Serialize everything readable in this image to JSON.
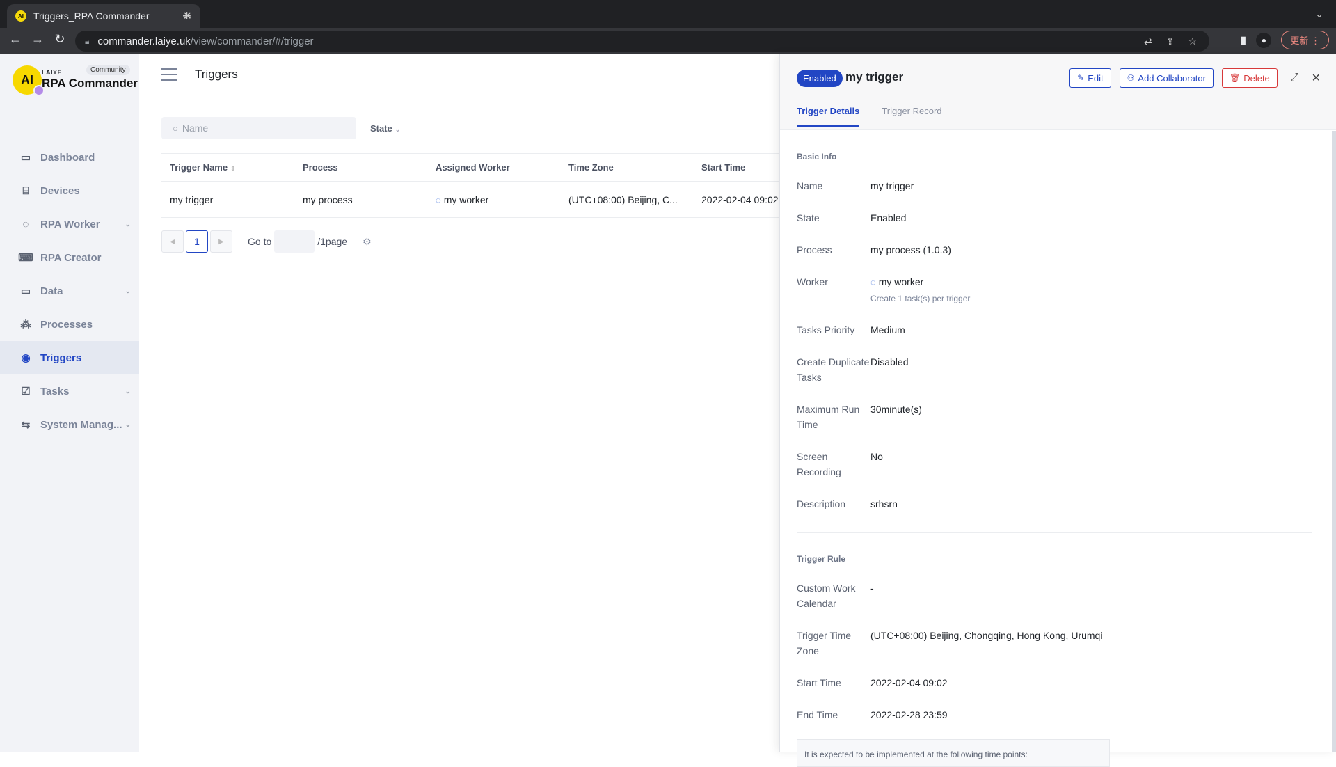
{
  "browser": {
    "tab_title": "Triggers_RPA Commander",
    "url_host": "commander.laiye.uk",
    "url_path": "/view/commander/#/trigger",
    "update_label": "更新"
  },
  "sidebar": {
    "brand_small": "LAIYE",
    "brand": "RPA Commander",
    "edition": "Community",
    "items": [
      {
        "label": "Dashboard",
        "icon": "monitor-chart-icon",
        "has_children": false
      },
      {
        "label": "Devices",
        "icon": "router-icon",
        "has_children": false
      },
      {
        "label": "RPA Worker",
        "icon": "robot-icon",
        "has_children": true
      },
      {
        "label": "RPA Creator",
        "icon": "terminal-icon",
        "has_children": false
      },
      {
        "label": "Data",
        "icon": "folder-icon",
        "has_children": true
      },
      {
        "label": "Processes",
        "icon": "flow-icon",
        "has_children": false
      },
      {
        "label": "Triggers",
        "icon": "broadcast-icon",
        "has_children": false,
        "active": true
      },
      {
        "label": "Tasks",
        "icon": "checkbox-icon",
        "has_children": true
      },
      {
        "label": "System Manag...",
        "icon": "settings-swap-icon",
        "has_children": true
      }
    ]
  },
  "main": {
    "title": "Triggers",
    "search_placeholder": "Name",
    "state_filter": "State",
    "columns": [
      "Trigger Name",
      "Process",
      "Assigned Worker",
      "Time Zone",
      "Start Time"
    ],
    "rows": [
      {
        "trigger_name": "my trigger",
        "process": "my process",
        "worker": "my worker",
        "time_zone": "(UTC+08:00) Beijing, C...",
        "start_time": "2022-02-04 09:02"
      }
    ],
    "pagination": {
      "current": "1",
      "goto_label": "Go to",
      "total_label": "/1page"
    }
  },
  "panel": {
    "status_badge": "Enabled",
    "title": "my trigger",
    "edit": "Edit",
    "add_collaborator": "Add Collaborator",
    "delete": "Delete",
    "tabs": [
      "Trigger Details",
      "Trigger Record"
    ],
    "basic_info_title": "Basic Info",
    "basic_info": [
      {
        "key": "Name",
        "value": "my trigger"
      },
      {
        "key": "State",
        "value": "Enabled"
      },
      {
        "key": "Process",
        "value": "my process (1.0.3)"
      },
      {
        "key": "Worker",
        "value": "my worker",
        "sub": "Create 1 task(s) per trigger"
      },
      {
        "key": "Tasks Priority",
        "value": "Medium"
      },
      {
        "key": "Create Duplicate Tasks",
        "value": "Disabled"
      },
      {
        "key": "Maximum Run Time",
        "value": "30minute(s)"
      },
      {
        "key": "Screen Recording",
        "value": "No"
      },
      {
        "key": "Description",
        "value": "srhsrn"
      }
    ],
    "trigger_rule_title": "Trigger Rule",
    "trigger_rule": [
      {
        "key": "Custom Work Calendar",
        "value": "-"
      },
      {
        "key": "Trigger Time Zone",
        "value": "(UTC+08:00) Beijing, Chongqing, Hong Kong, Urumqi"
      },
      {
        "key": "Start Time",
        "value": "2022-02-04 09:02"
      },
      {
        "key": "End Time",
        "value": "2022-02-28 23:59"
      }
    ],
    "expect_note": "It is expected to be implemented at the following time points:"
  },
  "colors": {
    "accent": "#2246c4",
    "danger": "#d7393a",
    "sidebar_bg": "#f2f3f7"
  }
}
